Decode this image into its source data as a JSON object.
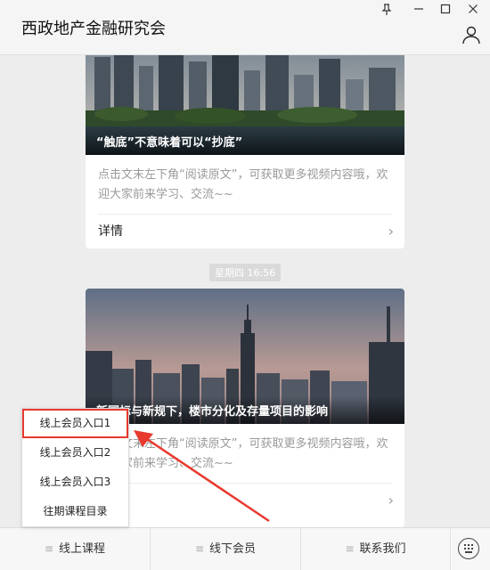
{
  "window": {
    "title": "西政地产金融研究会",
    "controls": [
      "pin-icon",
      "minimize-icon",
      "maximize-icon",
      "close-icon"
    ]
  },
  "cards": [
    {
      "caption": "“触底”不意味着可以“抄底”",
      "desc": "点击文末左下角“阅读原文”，可获取更多视频内容哦，欢迎大家前来学习、交流~~",
      "link": "详情"
    },
    {
      "caption": "新国标与新规下，楼市分化及存量项目的影响",
      "desc": "点击文末左下角“阅读原文”，可获取更多视频内容哦，欢迎大家前来学习、交流~~",
      "link": ""
    }
  ],
  "timestamp": "星期四 16:56",
  "bottom_menu": [
    {
      "label": "线上课程"
    },
    {
      "label": "线下会员"
    },
    {
      "label": "联系我们"
    }
  ],
  "submenu": [
    {
      "label": "线上会员入口1",
      "highlighted": true
    },
    {
      "label": "线上会员入口2"
    },
    {
      "label": "线上会员入口3"
    },
    {
      "label": "往期课程目录"
    }
  ],
  "colors": {
    "annotation": "#e8392f",
    "background": "#ededed"
  }
}
